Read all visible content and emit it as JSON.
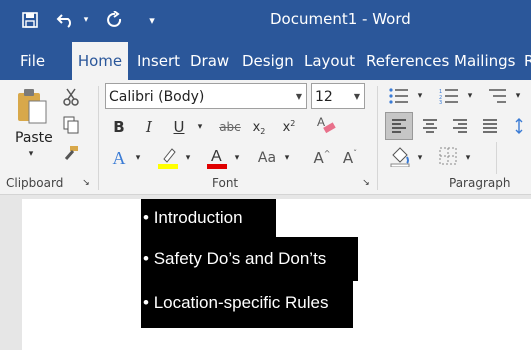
{
  "window": {
    "title": "Document1 - Word"
  },
  "quick_access": {
    "save_icon": "save-icon",
    "undo_icon": "undo-icon",
    "redo_icon": "redo-icon",
    "customize_icon": "customize-icon"
  },
  "tabs": [
    "File",
    "Home",
    "Insert",
    "Draw",
    "Design",
    "Layout",
    "References",
    "Mailings",
    "R"
  ],
  "active_tab": "Home",
  "clipboard": {
    "paste_label": "Paste",
    "group_label": "Clipboard"
  },
  "font": {
    "name": "Calibri (Body)",
    "size": "12",
    "group_label": "Font"
  },
  "paragraph": {
    "group_label": "Paragraph"
  },
  "document": {
    "bullets": [
      "Introduction",
      "Safety Do’s and Don’ts",
      "Location-specific Rules"
    ],
    "bullet_char": "•"
  },
  "colors": {
    "brand": "#2b579a",
    "highlight": "#ffff00",
    "font_color": "#e00000"
  }
}
